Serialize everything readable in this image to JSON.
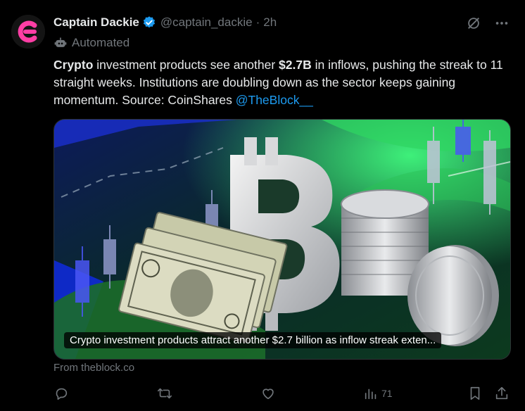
{
  "author": {
    "name": "Captain Dackie",
    "handle": "@captain_dackie",
    "separator": "·",
    "time": "2h",
    "label": "Automated"
  },
  "tweet": {
    "bold_word_1": "Crypto",
    "part_1": " investment products see another ",
    "bold_word_2": "$2.7B",
    "part_2": " in inflows, pushing the streak to 11 straight weeks. Institutions are doubling down as the sector keeps gaining momentum. Source: CoinShares ",
    "mention": "@TheBlock__"
  },
  "card": {
    "caption": "Crypto investment products attract another $2.7 billion as inflow streak exten...",
    "source": "From theblock.co"
  },
  "metrics": {
    "views": "71"
  },
  "colors": {
    "accent": "#1d9bf0",
    "avatar": "#ff3ea5",
    "muted": "#71767b"
  }
}
